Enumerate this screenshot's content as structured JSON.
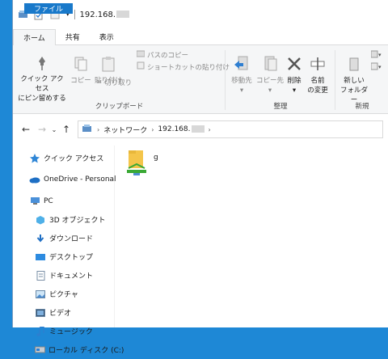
{
  "title": "192.168.",
  "tabs": [
    "ファイル",
    "ホーム",
    "共有",
    "表示"
  ],
  "ribbon": {
    "pin_line1": "クイック アクセス",
    "pin_line2": "にピン留めする",
    "copy": "コピー",
    "paste": "貼り付け",
    "copy_path": "パスのコピー",
    "paste_shortcut": "ショートカットの貼り付け",
    "cut": "切り取り",
    "clipboard_group": "クリップボード",
    "move_to": "移動先",
    "copy_to": "コピー先",
    "delete": "削除",
    "rename_line1": "名前",
    "rename_line2": "の変更",
    "new_folder_line1": "新しい",
    "new_folder_line2": "フォルダー",
    "organize_group": "整理",
    "new_group": "新規"
  },
  "address": {
    "network": "ネットワーク",
    "ip": "192.168."
  },
  "nav": {
    "quick_access": "クイック アクセス",
    "onedrive": "OneDrive - Personal",
    "pc": "PC",
    "objects3d": "3D オブジェクト",
    "downloads": "ダウンロード",
    "desktop": "デスクトップ",
    "documents": "ドキュメント",
    "pictures": "ピクチャ",
    "videos": "ビデオ",
    "music": "ミュージック",
    "local_disk": "ローカル ディスク (C:)"
  },
  "files": [
    {
      "name": "g"
    }
  ],
  "colors": {
    "accent": "#1979ca",
    "desktop": "#1e88d6",
    "folder": "#f4c54a",
    "share": "#3aa935"
  }
}
